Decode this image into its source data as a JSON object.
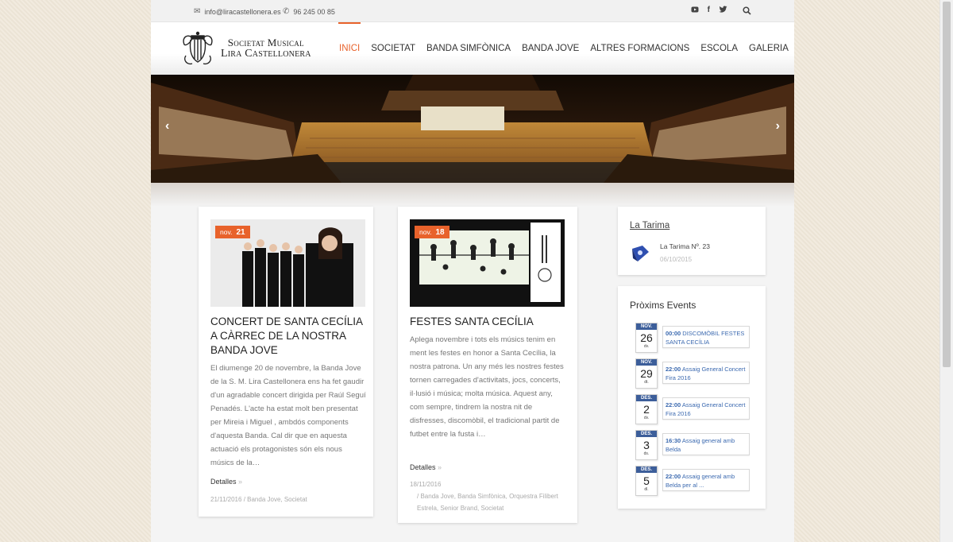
{
  "topbar": {
    "email": "info@liracastellonera.es",
    "phone": "96 245 00 85",
    "social": [
      "youtube-icon",
      "facebook-icon",
      "twitter-icon"
    ]
  },
  "logo": {
    "line1": "Societat Musical",
    "line2": "Lira Castellonera"
  },
  "nav": [
    {
      "label": "INICI",
      "active": true
    },
    {
      "label": "SOCIETAT"
    },
    {
      "label": "BANDA SIMFÒNICA"
    },
    {
      "label": "BANDA JOVE"
    },
    {
      "label": "ALTRES FORMACIONS"
    },
    {
      "label": "ESCOLA"
    },
    {
      "label": "GALERIA"
    }
  ],
  "posts": [
    {
      "month": "nov.",
      "day": "21",
      "title": "CONCERT DE SANTA CECÍLIA A CÀRREC DE LA NOSTRA BANDA JOVE",
      "body": "El diumenge 20 de novembre, la Banda Jove de la S. M. Lira Castellonera ens ha fet gaudir d'un agradable concert dirigida per Raúl Seguí Penadés. L'acte ha estat molt ben presentat per Mireia i Miguel , ambdós components d'aquesta Banda. Cal dir que en aquesta actuació els protagonistes són els nous músics de la…",
      "more": "Detalles",
      "date": "21/11/2016",
      "categories": "Banda Jove, Societat"
    },
    {
      "month": "nov.",
      "day": "18",
      "title": "FESTES SANTA CECÍLIA",
      "body": "Aplega novembre i tots els músics tenim en ment les festes en honor a Santa Cecília, la nostra patrona. Un any més les nostres festes tornen carregades d'activitats, jocs, concerts, il·lusió i música; molta música. Aquest any, com sempre, tindrem la nostra nit de disfresses, discomòbil, el tradicional partit de futbet entre la fusta i…",
      "more": "Detalles",
      "date": "18/11/2016",
      "categories": "Banda Jove, Banda Simfònica, Orquestra Filibert Estrela, Senior Brand, Societat"
    }
  ],
  "tarima": {
    "heading": "La Tarima",
    "item": "La Tarima Nº. 23",
    "date": "06/10/2015"
  },
  "events": {
    "heading": "Pròxims Events",
    "items": [
      {
        "mon": "NOV.",
        "day": "26",
        "dw": "dv.",
        "time": "00:00",
        "title": "DISCOMÒBIL FESTES SANTA CECÍLIA"
      },
      {
        "mon": "NOV.",
        "day": "29",
        "dw": "dt.",
        "time": "22:00",
        "title": "Assaig General Concert Fira 2016"
      },
      {
        "mon": "DES.",
        "day": "2",
        "dw": "dv.",
        "time": "22:00",
        "title": "Assaig General Concert Fira 2016"
      },
      {
        "mon": "DES.",
        "day": "3",
        "dw": "ds.",
        "time": "16:30",
        "title": "Assaig general amb Belda"
      },
      {
        "mon": "DES.",
        "day": "5",
        "dw": "dl.",
        "time": "22:00",
        "title": "Assaig general amb Belda per al ..."
      }
    ]
  },
  "colors": {
    "accent": "#e8622b",
    "calendar": "#3c5e9a",
    "link": "#3c6ab0"
  }
}
